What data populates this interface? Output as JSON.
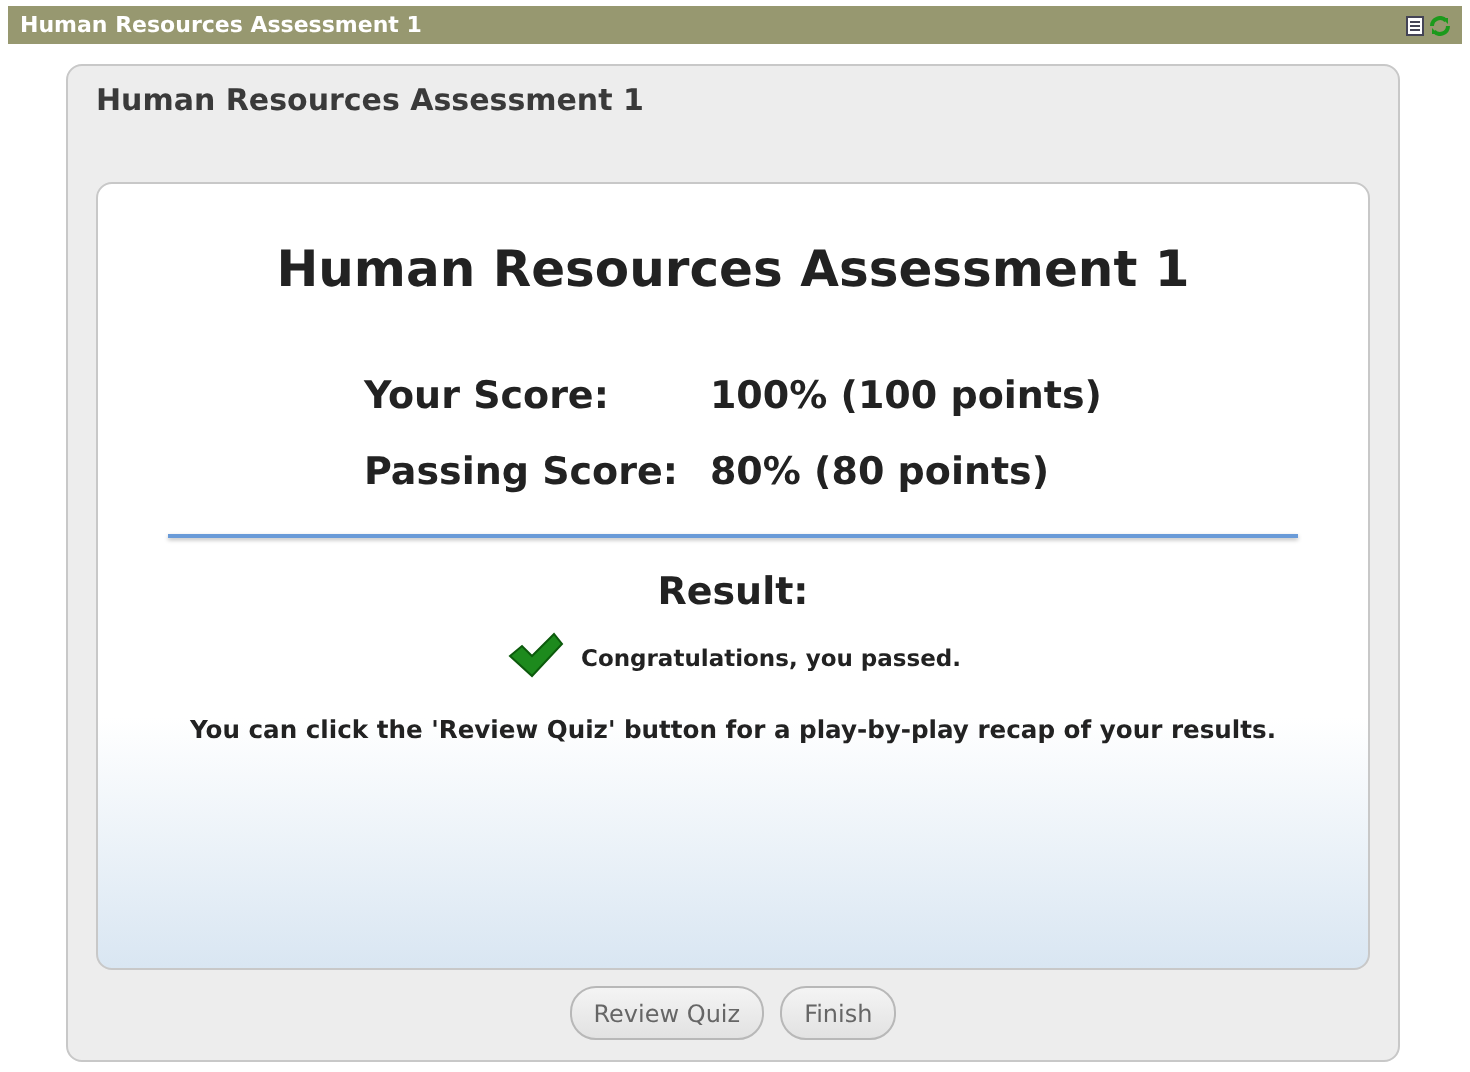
{
  "window": {
    "title": "Human Resources Assessment 1"
  },
  "panel": {
    "title": "Human Resources Assessment 1"
  },
  "result": {
    "heading": "Human Resources Assessment 1",
    "scores": [
      {
        "label": "Your Score:",
        "value": "100% (100 points)"
      },
      {
        "label": "Passing Score:",
        "value": "80% (80 points)"
      }
    ],
    "result_label": "Result:",
    "passed": true,
    "message": "Congratulations, you passed.",
    "hint": "You can click the 'Review Quiz' button for a play-by-play recap of your results."
  },
  "buttons": [
    {
      "label": "Review Quiz"
    },
    {
      "label": "Finish"
    }
  ]
}
